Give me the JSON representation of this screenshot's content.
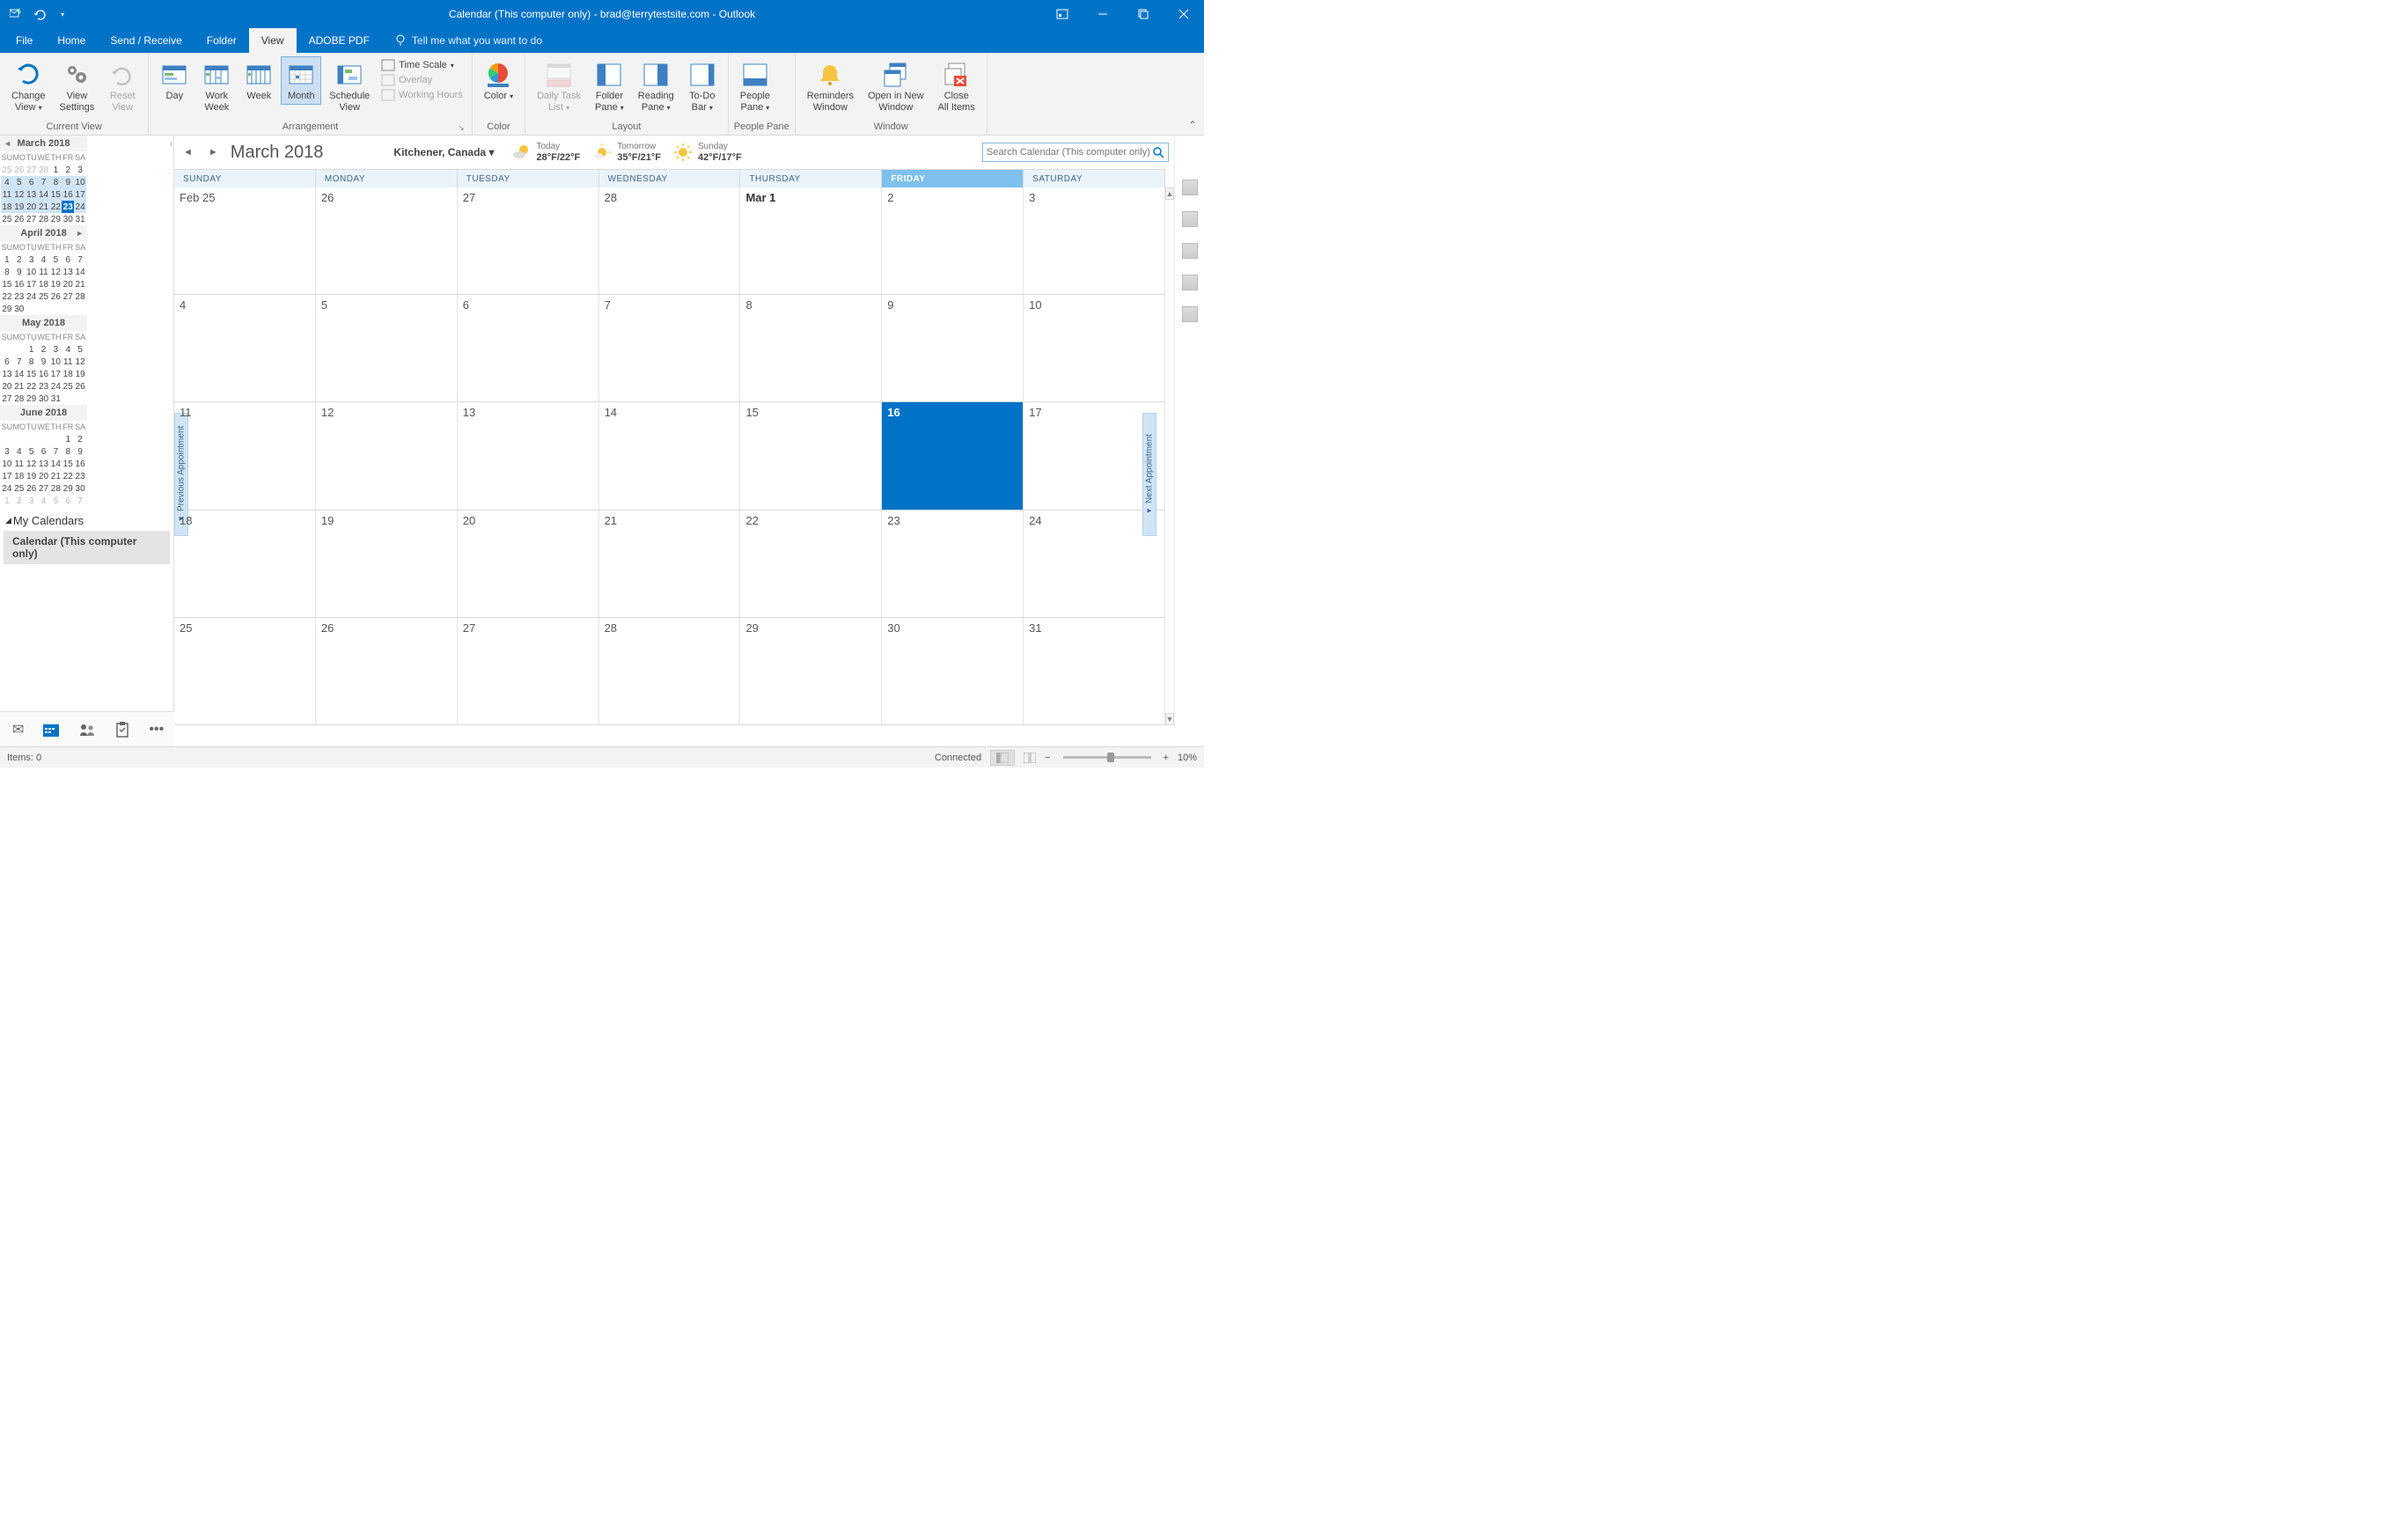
{
  "title": "Calendar (This computer only) - brad@terrytestsite.com  -  Outlook",
  "menus": [
    "File",
    "Home",
    "Send / Receive",
    "Folder",
    "View",
    "ADOBE PDF"
  ],
  "activeMenu": "View",
  "tellme": "Tell me what you want to do",
  "ribbon": {
    "groups": [
      {
        "label": "Current View",
        "items": [
          {
            "label": "Change\nView",
            "drop": true,
            "icon": "change-view"
          },
          {
            "label": "View\nSettings",
            "icon": "view-settings"
          },
          {
            "label": "Reset\nView",
            "icon": "reset-view",
            "disabled": true
          }
        ]
      },
      {
        "label": "Arrangement",
        "launcher": true,
        "items": [
          {
            "label": "Day",
            "icon": "cal-day"
          },
          {
            "label": "Work\nWeek",
            "icon": "cal-workweek"
          },
          {
            "label": "Week",
            "icon": "cal-week"
          },
          {
            "label": "Month",
            "icon": "cal-month",
            "selected": true
          },
          {
            "label": "Schedule\nView",
            "icon": "cal-schedule"
          }
        ],
        "extras": [
          {
            "label": "Time Scale",
            "drop": true,
            "icon": "time-scale"
          },
          {
            "label": "Overlay",
            "icon": "overlay",
            "disabled": true
          },
          {
            "label": "Working Hours",
            "icon": "working-hours",
            "disabled": true
          }
        ]
      },
      {
        "label": "Color",
        "items": [
          {
            "label": "Color",
            "drop": true,
            "icon": "color"
          }
        ]
      },
      {
        "label": "Layout",
        "items": [
          {
            "label": "Daily Task\nList",
            "drop": true,
            "icon": "task-list",
            "disabled": true
          },
          {
            "label": "Folder\nPane",
            "drop": true,
            "icon": "folder-pane"
          },
          {
            "label": "Reading\nPane",
            "drop": true,
            "icon": "reading-pane"
          },
          {
            "label": "To-Do\nBar",
            "drop": true,
            "icon": "todo-bar"
          }
        ]
      },
      {
        "label": "People Pane",
        "items": [
          {
            "label": "People\nPane",
            "drop": true,
            "icon": "people-pane"
          }
        ]
      },
      {
        "label": "Window",
        "items": [
          {
            "label": "Reminders\nWindow",
            "icon": "reminders"
          },
          {
            "label": "Open in New\nWindow",
            "icon": "new-window"
          },
          {
            "label": "Close\nAll Items",
            "icon": "close-all"
          }
        ]
      }
    ]
  },
  "miniCals": [
    {
      "title": "March 2018",
      "navLeft": true,
      "rows": [
        [
          "25",
          "26",
          "27",
          "28",
          "1",
          "2",
          "3"
        ],
        [
          "4",
          "5",
          "6",
          "7",
          "8",
          "9",
          "10"
        ],
        [
          "11",
          "12",
          "13",
          "14",
          "15",
          "16",
          "17"
        ],
        [
          "18",
          "19",
          "20",
          "21",
          "22",
          "23",
          "24"
        ],
        [
          "25",
          "26",
          "27",
          "28",
          "29",
          "30",
          "31"
        ]
      ],
      "prevCount": 4,
      "today": [
        3,
        5
      ],
      "hlStart": [
        1,
        0
      ],
      "hlEnd": [
        3,
        6
      ]
    },
    {
      "title": "April 2018",
      "navRight": true,
      "rows": [
        [
          "1",
          "2",
          "3",
          "4",
          "5",
          "6",
          "7"
        ],
        [
          "8",
          "9",
          "10",
          "11",
          "12",
          "13",
          "14"
        ],
        [
          "15",
          "16",
          "17",
          "18",
          "19",
          "20",
          "21"
        ],
        [
          "22",
          "23",
          "24",
          "25",
          "26",
          "27",
          "28"
        ],
        [
          "29",
          "30",
          "",
          "",
          "",
          "",
          ""
        ]
      ]
    },
    {
      "title": "May 2018",
      "rows": [
        [
          "",
          "",
          "1",
          "2",
          "3",
          "4",
          "5"
        ],
        [
          "6",
          "7",
          "8",
          "9",
          "10",
          "11",
          "12"
        ],
        [
          "13",
          "14",
          "15",
          "16",
          "17",
          "18",
          "19"
        ],
        [
          "20",
          "21",
          "22",
          "23",
          "24",
          "25",
          "26"
        ],
        [
          "27",
          "28",
          "29",
          "30",
          "31",
          "",
          ""
        ]
      ]
    },
    {
      "title": "June 2018",
      "rows": [
        [
          "",
          "",
          "",
          "",
          "",
          "1",
          "2"
        ],
        [
          "3",
          "4",
          "5",
          "6",
          "7",
          "8",
          "9"
        ],
        [
          "10",
          "11",
          "12",
          "13",
          "14",
          "15",
          "16"
        ],
        [
          "17",
          "18",
          "19",
          "20",
          "21",
          "22",
          "23"
        ],
        [
          "24",
          "25",
          "26",
          "27",
          "28",
          "29",
          "30"
        ],
        [
          "1",
          "2",
          "3",
          "4",
          "5",
          "6",
          "7"
        ]
      ],
      "nextRow": 5
    }
  ],
  "dow": [
    "SU",
    "MO",
    "TU",
    "WE",
    "TH",
    "FR",
    "SA"
  ],
  "myCalendarsHeader": "My Calendars",
  "calendarItem": "Calendar (This computer only)",
  "calTitle": "March 2018",
  "location": "Kitchener, Canada",
  "weather": [
    {
      "day": "Today",
      "temp": "28°F/22°F",
      "icon": "partly-cloudy"
    },
    {
      "day": "Tomorrow",
      "temp": "35°F/21°F",
      "icon": "partly-sunny"
    },
    {
      "day": "Sunday",
      "temp": "42°F/17°F",
      "icon": "sunny"
    }
  ],
  "searchPlaceholder": "Search Calendar (This computer only)",
  "dayHeaders": [
    "SUNDAY",
    "MONDAY",
    "TUESDAY",
    "WEDNESDAY",
    "THURSDAY",
    "FRIDAY",
    "SATURDAY"
  ],
  "todayCol": 5,
  "weeks": [
    [
      "Feb 25",
      "26",
      "27",
      "28",
      "Mar 1",
      "2",
      "3"
    ],
    [
      "4",
      "5",
      "6",
      "7",
      "8",
      "9",
      "10"
    ],
    [
      "11",
      "12",
      "13",
      "14",
      "15",
      "16",
      "17"
    ],
    [
      "18",
      "19",
      "20",
      "21",
      "22",
      "23",
      "24"
    ],
    [
      "25",
      "26",
      "27",
      "28",
      "29",
      "30",
      "31"
    ]
  ],
  "firstOfMonth": [
    [
      0,
      4
    ]
  ],
  "todayCell": [
    2,
    5
  ],
  "prevTab": "Previous Appointment",
  "nextTab": "Next Appointment",
  "status": {
    "items": "Items: 0",
    "connected": "Connected",
    "zoom": "10%"
  }
}
